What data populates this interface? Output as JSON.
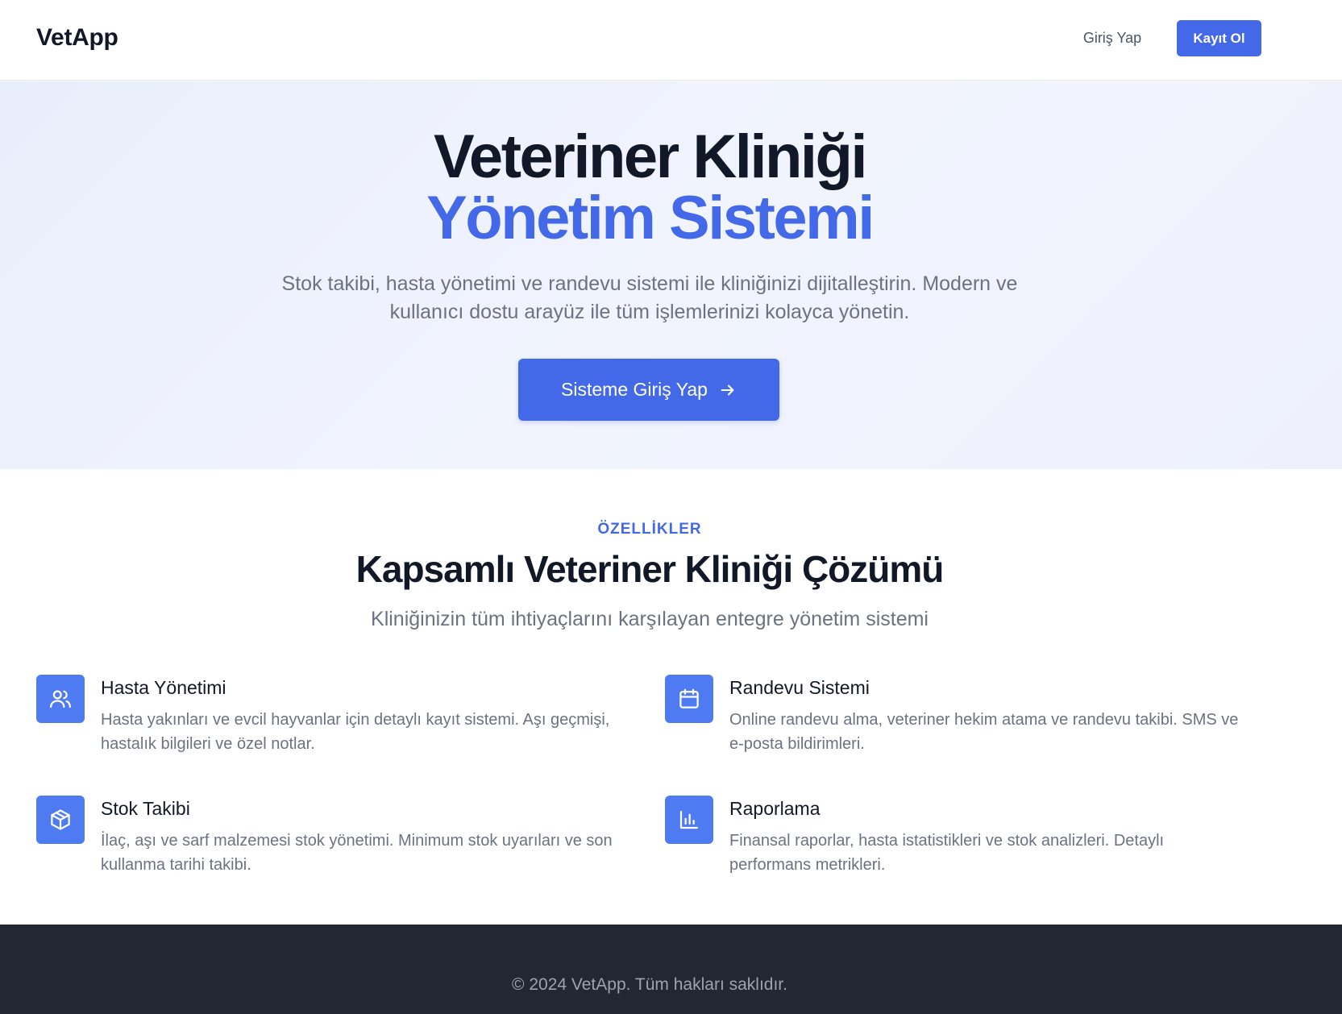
{
  "navbar": {
    "brand": "VetApp",
    "login_label": "Giriş Yap",
    "register_label": "Kayıt Ol"
  },
  "hero": {
    "title_line1": "Veteriner Kliniği",
    "title_line2": "Yönetim Sistemi",
    "subtitle": "Stok takibi, hasta yönetimi ve randevu sistemi ile kliniğinizi dijitalleştirin. Modern ve kullanıcı dostu arayüz ile tüm işlemlerinizi kolayca yönetin.",
    "cta_label": "Sisteme Giriş Yap",
    "cta_icon": "arrow-right-icon"
  },
  "features": {
    "eyebrow": "ÖZELLİKLER",
    "title": "Kapsamlı Veteriner Kliniği Çözümü",
    "subtitle": "Kliniğinizin tüm ihtiyaçlarını karşılayan entegre yönetim sistemi",
    "items": [
      {
        "icon": "users-icon",
        "title": "Hasta Yönetimi",
        "description": "Hasta yakınları ve evcil hayvanlar için detaylı kayıt sistemi. Aşı geçmişi, hastalık bilgileri ve özel notlar."
      },
      {
        "icon": "calendar-icon",
        "title": "Randevu Sistemi",
        "description": "Online randevu alma, veteriner hekim atama ve randevu takibi. SMS ve e-posta bildirimleri."
      },
      {
        "icon": "box-icon",
        "title": "Stok Takibi",
        "description": "İlaç, aşı ve sarf malzemesi stok yönetimi. Minimum stok uyarıları ve son kullanma tarihi takibi."
      },
      {
        "icon": "bar-chart-icon",
        "title": "Raporlama",
        "description": "Finansal raporlar, hasta istatistikleri ve stok analizleri. Detaylı performans metrikleri."
      }
    ]
  },
  "footer": {
    "copyright": "© 2024 VetApp. Tüm hakları saklıdır."
  },
  "colors": {
    "accent": "#4368e8",
    "icon_bg": "#4e7af2",
    "footer_bg": "#222833",
    "heading": "#111827",
    "muted": "#6b7280"
  }
}
